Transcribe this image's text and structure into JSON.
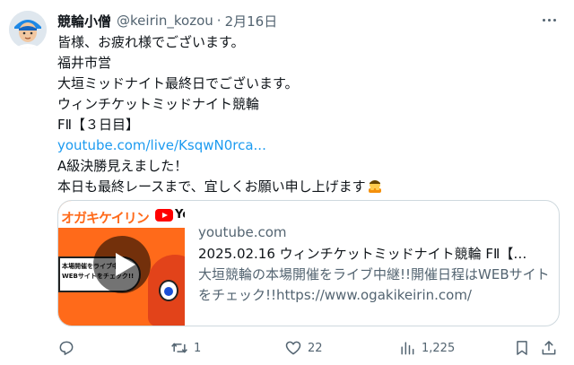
{
  "author": {
    "name": "競輪小僧",
    "handle": "@keirin_kozou",
    "separator": "·",
    "date": "2月16日"
  },
  "tweet": {
    "lines": [
      "皆様、お疲れ様でございます。",
      "福井市営",
      "大垣ミッドナイト最終日でございます。",
      "ウィンチケットミッドナイト競輪",
      "FⅡ【３日目】"
    ],
    "link": "youtube.com/live/KsqwN0rca...",
    "lines_after": [
      "A級決勝見えました！",
      "本日も最終レースまで、宜しくお願い申し上げます"
    ],
    "emoji": "bowing-person-emoji"
  },
  "card": {
    "thumbnail": {
      "brand_text": "オガキケイリン",
      "yt_text": "Yo",
      "bubble_line_1": "本場開催をライブ中",
      "bubble_line_2": "WEBサイトをチェック!!"
    },
    "domain": "youtube.com",
    "title": "2025.02.16 ウィンチケットミッドナイト競輪 FⅡ【…",
    "description": "大垣競輪の本場開催をライブ中継!!開催日程はWEBサイトをチェック!!https://www.ogakikeirin.com/"
  },
  "actions": {
    "reply": {
      "icon": "reply-icon",
      "count": ""
    },
    "retweet": {
      "icon": "retweet-icon",
      "count": "1"
    },
    "like": {
      "icon": "heart-icon",
      "count": "22"
    },
    "views": {
      "icon": "views-icon",
      "count": "1,225"
    },
    "bookmark": {
      "icon": "bookmark-icon"
    },
    "share": {
      "icon": "share-icon"
    }
  },
  "colors": {
    "text": "#0f1419",
    "secondary": "#536471",
    "link": "#1d9bf0",
    "border": "#cfd9de",
    "thumbnail_orange": "#ff6a1a"
  }
}
